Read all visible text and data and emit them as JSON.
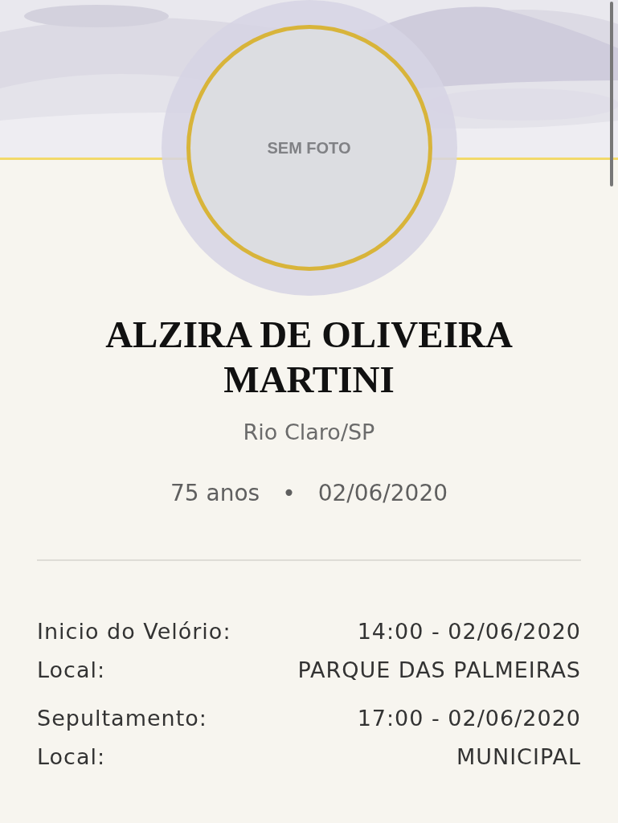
{
  "photo": {
    "placeholder": "SEM FOTO"
  },
  "name": "ALZIRA DE OLIVEIRA MARTINI",
  "city": "Rio Claro/SP",
  "age": "75 anos",
  "separator": "•",
  "date": "02/06/2020",
  "events": [
    {
      "rows": [
        {
          "label": "Inicio do Velório:",
          "value": "14:00 - 02/06/2020"
        },
        {
          "label": "Local:",
          "value": "PARQUE DAS PALMEIRAS"
        }
      ]
    },
    {
      "rows": [
        {
          "label": "Sepultamento:",
          "value": "17:00 - 02/06/2020"
        },
        {
          "label": "Local:",
          "value": "MUNICIPAL"
        }
      ]
    }
  ]
}
